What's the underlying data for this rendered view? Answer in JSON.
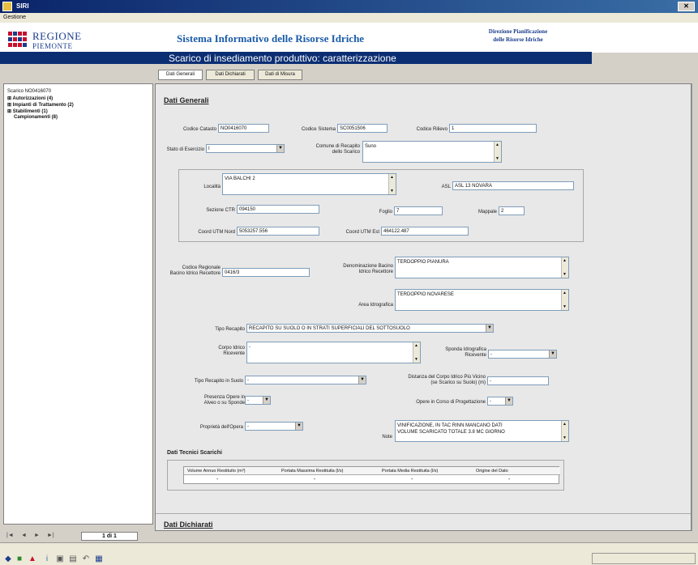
{
  "window": {
    "title": "SIRI",
    "close": "✕"
  },
  "menu": {
    "gestione": "Gestione"
  },
  "header": {
    "logo_line1": "REGIONE",
    "logo_line2": "PIEMONTE",
    "system_title": "Sistema Informativo delle Risorse Idriche",
    "direzione_line1": "Direzione Pianificazione",
    "direzione_line2": "delle Risorse Idriche",
    "page_title": "Scarico di insediamento produttivo: caratterizzazione",
    "brand_colors": {
      "dark_blue": "#0b2e73",
      "red": "#c8102e"
    }
  },
  "tabs": [
    "Dati Generali",
    "Dati Dichiarati",
    "Dati di Misura"
  ],
  "tree": {
    "root": "Scarico NO0416070",
    "items": [
      "Autorizzazioni (4)",
      "Impianti di Trattamento (2)",
      "Stabilimenti (1)",
      "Campionamenti (8)"
    ]
  },
  "form": {
    "section1": "Dati Generali",
    "codice_catasto": {
      "label": "Codice Catasto",
      "value": "NO0416070"
    },
    "codice_sistema": {
      "label": "Codice Sistema",
      "value": "SC0051506"
    },
    "codice_rilievo": {
      "label": "Codice Rilievo",
      "value": "1"
    },
    "stato_esercizio": {
      "label": "Stato di Esercizio",
      "value": "I"
    },
    "comune_recapito": {
      "label1": "Comune di Recapito",
      "label2": "dello Scarico",
      "value": "Suno"
    },
    "localita": {
      "label": "Località",
      "value": "VIA BALCHI 2"
    },
    "asl": {
      "label": "ASL",
      "value": "ASL 13 NOVARA"
    },
    "sezione_ctr": {
      "label": "Sezione CTR",
      "value": "094150"
    },
    "foglio": {
      "label": "Foglio",
      "value": "7"
    },
    "mappale": {
      "label": "Mappale",
      "value": "2"
    },
    "utm_nord": {
      "label": "Coord UTM Nord",
      "value": "5053257.556"
    },
    "utm_est": {
      "label": "Coord UTM Est",
      "value": "464122.487"
    },
    "codice_reg": {
      "label1": "Codice Regionale",
      "label2": "Bacino Idrico Recettore",
      "value": "0416/3"
    },
    "denom_bacino": {
      "label1": "Denominazione Bacino",
      "label2": "Idrico Recettore",
      "value": "TERDOPPIO PIANURA"
    },
    "area_idro": {
      "label": "Area Idrografica",
      "value": "TERDOPPIO NOVARESE"
    },
    "tipo_recapito": {
      "label": "Tipo Recapito",
      "value": "RECAPITO SU SUOLO O IN STRATI SUPERFICIALI DEL SOTTOSUOLO"
    },
    "corpo_idrico": {
      "label1": "Corpo Idrico",
      "label2": "Ricevente",
      "value": "-"
    },
    "sponda": {
      "label1": "Sponda Idrografica",
      "label2": "Ricevente",
      "value": "-"
    },
    "tipo_recapito_suolo": {
      "label": "Tipo Recapito in Suolo",
      "value": "-"
    },
    "distanza": {
      "label1": "Distanza del Corpo Idrico Più Vicino",
      "label2": "(se Scarico su Suolo) (m)",
      "value": "-"
    },
    "presenza_opere": {
      "label1": "Presenza Opere in",
      "label2": "Alveo o su Sponde",
      "value": "-"
    },
    "opere_corso": {
      "label": "Opere in Corso di Progettazione",
      "value": "-"
    },
    "proprieta": {
      "label": "Proprietà dell'Opera",
      "value": "-"
    },
    "note": {
      "label": "Note",
      "line1": "VINIFICAZIONE, IN TAC RINN MANCANO DATI",
      "line2": "VOLUME SCARICATO TOTALE 3.8 MC GIORNO"
    },
    "dati_tecnici": "Dati Tecnici Scarichi",
    "table_headers": [
      "Volume Annuo Restituito (m³)",
      "Portata Massima Restituita (l/s)",
      "Portata Media Restituita (l/s)",
      "Origine del Dato"
    ],
    "table_row": [
      "-",
      "-",
      "-",
      "-"
    ],
    "section2": "Dati Dichiarati"
  },
  "nav": {
    "page": "1 di 1"
  }
}
